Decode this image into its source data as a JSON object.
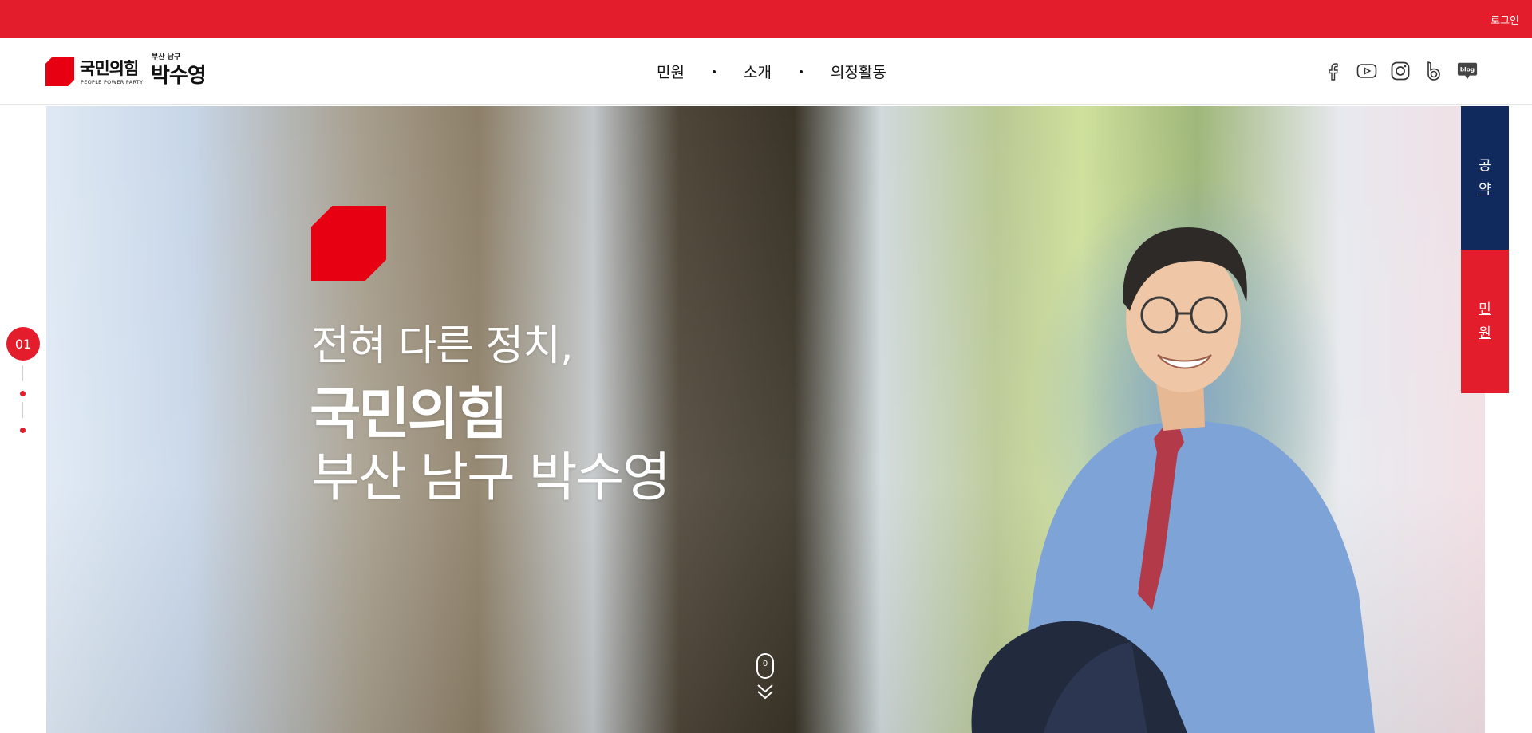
{
  "topbar": {
    "login_label": "로그인"
  },
  "header": {
    "logo": {
      "party_name": "국민의힘",
      "party_name_en": "PEOPLE POWER PARTY",
      "region": "부산 남구",
      "member_name": "박수영"
    },
    "nav": [
      {
        "label": "민원"
      },
      {
        "label": "소개"
      },
      {
        "label": "의정활동"
      }
    ],
    "sns": [
      {
        "icon": "facebook-icon"
      },
      {
        "icon": "youtube-icon"
      },
      {
        "icon": "instagram-icon"
      },
      {
        "icon": "band-icon"
      },
      {
        "icon": "blog-icon",
        "label": "blog"
      }
    ]
  },
  "hero": {
    "line1": "전혀 다른 정치,",
    "line2": "국민의힘",
    "line3": "부산 남구 박수영",
    "scroll_label": "0"
  },
  "pager": {
    "active_label": "01"
  },
  "side_tabs": [
    {
      "chars": [
        "공",
        "약"
      ]
    },
    {
      "chars": [
        "민",
        "원"
      ]
    }
  ],
  "colors": {
    "brand_red": "#e41d2d",
    "logo_red": "#e60012",
    "navy": "#112a5e"
  }
}
